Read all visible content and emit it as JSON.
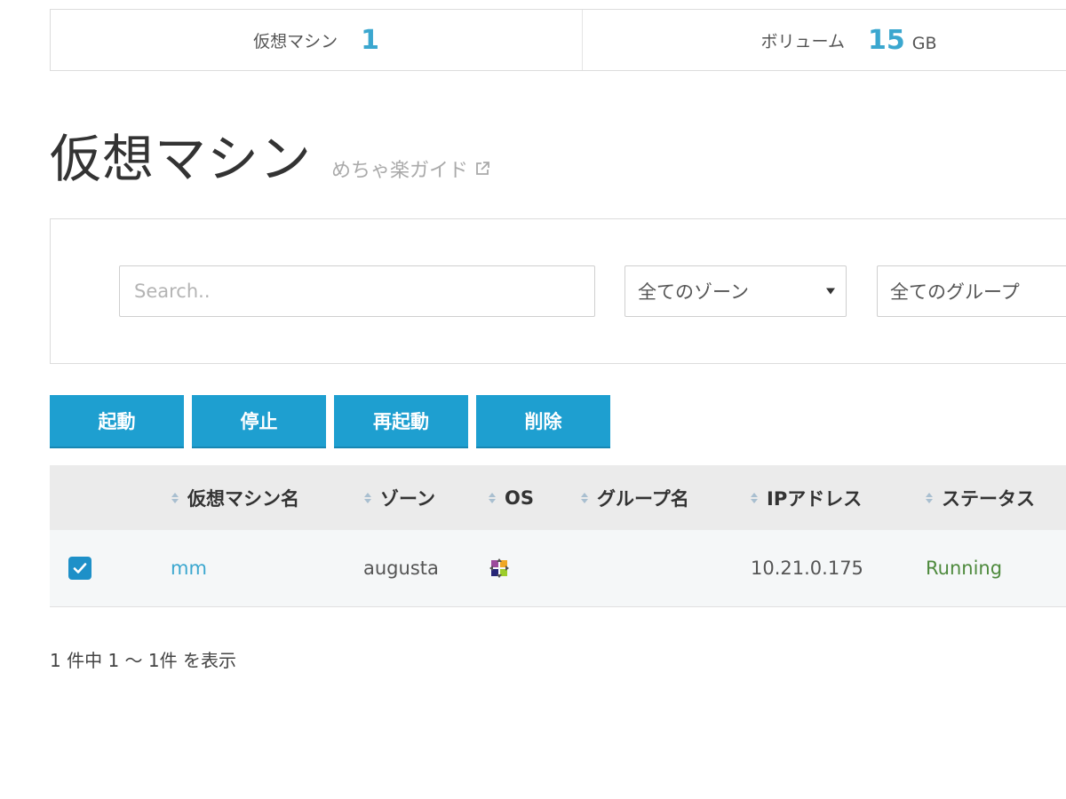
{
  "stats": {
    "vm": {
      "label": "仮想マシン",
      "value": "1"
    },
    "volume": {
      "label": "ボリューム",
      "value": "15",
      "unit": "GB"
    }
  },
  "page": {
    "title": "仮想マシン",
    "guide_link": "めちゃ楽ガイド"
  },
  "filters": {
    "search_placeholder": "Search..",
    "zone_select": "全てのゾーン",
    "group_select": "全てのグループ"
  },
  "actions": {
    "start": "起動",
    "stop": "停止",
    "restart": "再起動",
    "delete": "削除"
  },
  "table": {
    "columns": {
      "name": "仮想マシン名",
      "zone": "ゾーン",
      "os": "OS",
      "group": "グループ名",
      "ip": "IPアドレス",
      "status": "ステータス"
    },
    "rows": [
      {
        "checked": true,
        "name": "mm",
        "zone": "augusta",
        "os_icon": "centos-logo-icon",
        "group": "",
        "ip": "10.21.0.175",
        "status": "Running"
      }
    ]
  },
  "pager": {
    "info": "1 件中 1 〜 1件 を表示"
  },
  "colors": {
    "accent": "#1e9fd0",
    "stat_value": "#3ba7cf",
    "status_running": "#4e8a3d"
  }
}
